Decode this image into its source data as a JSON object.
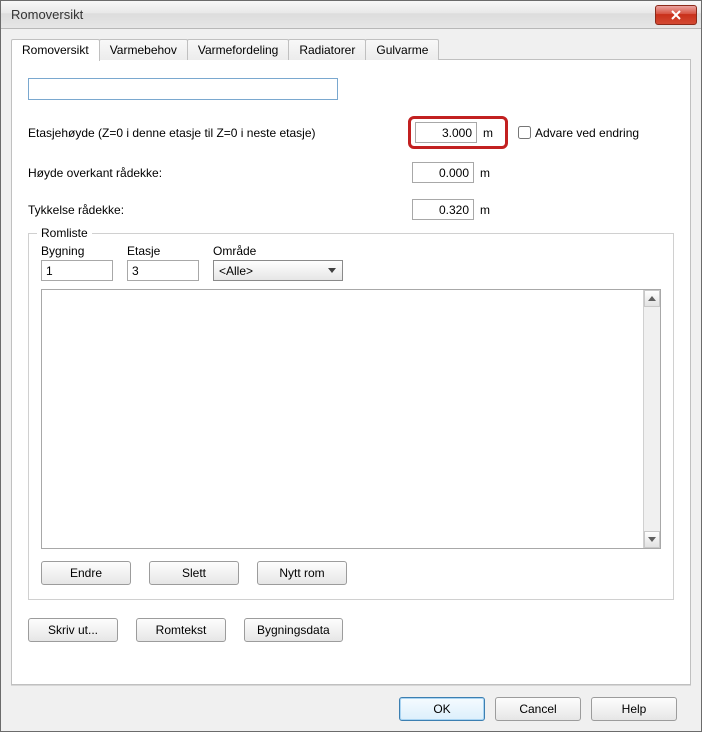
{
  "window": {
    "title": "Romoversikt"
  },
  "tabs": [
    {
      "label": "Romoversikt"
    },
    {
      "label": "Varmebehov"
    },
    {
      "label": "Varmefordeling"
    },
    {
      "label": "Radiatorer"
    },
    {
      "label": "Gulvarme"
    }
  ],
  "fields": {
    "top_input_value": "",
    "etasjehoyde_label": "Etasjehøyde (Z=0 i denne etasje til Z=0 i neste etasje)",
    "etasjehoyde_value": "3.000",
    "etasjehoyde_unit": "m",
    "advare_label": "Advare ved endring",
    "advare_checked": false,
    "hoyde_label": "Høyde overkant rådekke:",
    "hoyde_value": "0.000",
    "hoyde_unit": "m",
    "tykkelse_label": "Tykkelse rådekke:",
    "tykkelse_value": "0.320",
    "tykkelse_unit": "m"
  },
  "romliste": {
    "legend": "Romliste",
    "bygning_label": "Bygning",
    "bygning_value": "1",
    "etasje_label": "Etasje",
    "etasje_value": "3",
    "omrade_label": "Område",
    "omrade_value": "<Alle>",
    "buttons": {
      "endre": "Endre",
      "slett": "Slett",
      "nytt_rom": "Nytt rom"
    }
  },
  "bottom_buttons": {
    "skriv_ut": "Skriv ut...",
    "romtekst": "Romtekst",
    "bygningsdata": "Bygningsdata"
  },
  "footer": {
    "ok": "OK",
    "cancel": "Cancel",
    "help": "Help"
  }
}
